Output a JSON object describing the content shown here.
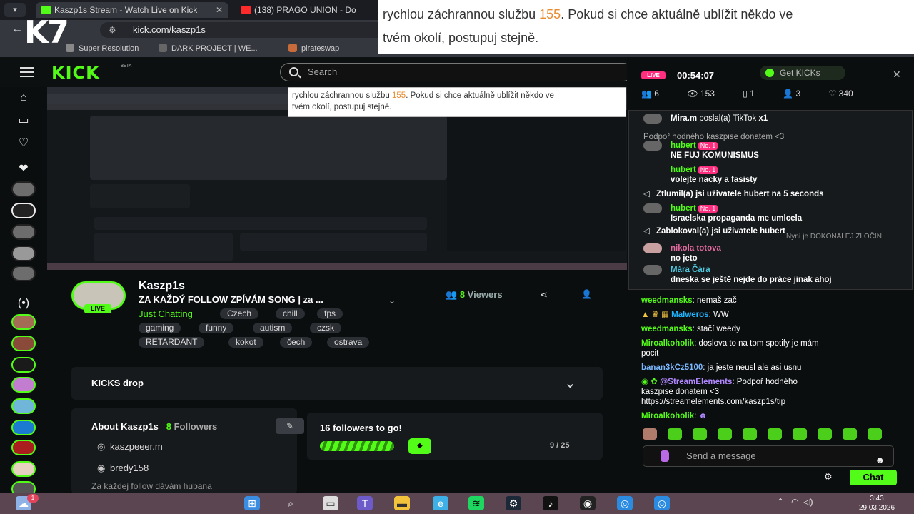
{
  "browser": {
    "tabs": [
      {
        "title": "Kaszp1s Stream - Watch Live on Kick",
        "active": true
      },
      {
        "title": "(138) PRAGO UNION - Do",
        "active": false
      }
    ],
    "url": "kick.com/kaszp1s",
    "bookmarks": [
      "Super Resolution",
      "DARK PROJECT | WE...",
      "pirateswap"
    ]
  },
  "overlay_logo": "K7",
  "top_popup": {
    "line1_pre": "rychlou záchrannou službu ",
    "line1_num": "155",
    "line1_post": ". Pokud si chce aktuálně ublížit někdo ve",
    "line2": "tvém okolí, postupuj stejně."
  },
  "header": {
    "logo": "KICK",
    "beta": "BETA",
    "search_placeholder": "Search"
  },
  "preview_popup": {
    "line1_pre": "rychlou záchrannou službu ",
    "line1_num": "155",
    "line1_post": ". Pokud si chce aktuálně ublížit někdo ve",
    "line2": "tvém okolí, postupuj stejně."
  },
  "channel": {
    "name": "Kaszp1s",
    "live_badge": "LIVE",
    "title": "ZA KAŽDÝ FOLLOW ZPÍVÁM SONG | za ...",
    "category": "Just Chatting",
    "tags": [
      "Czech",
      "chill",
      "fps",
      "gaming",
      "funny",
      "autism",
      "czsk",
      "RETARDANT",
      "kokot",
      "čech",
      "ostrava"
    ],
    "viewers_count": "8",
    "viewers_label": "Viewers"
  },
  "kicks_drop": {
    "label": "KICKS drop"
  },
  "about": {
    "title": "About Kaszp1s",
    "followers_count": "8",
    "followers_label": "Followers",
    "instagram": "kaszpeeer.m",
    "discord": "bredy158",
    "description": "Za každej follow dávám hubana"
  },
  "goal": {
    "title": "16 followers to go!",
    "current": 9,
    "target": 25,
    "progress_text": "9 / 25"
  },
  "chat": {
    "live_badge": "LIVE",
    "uptime": "00:54:07",
    "get_kicks": "Get KICKs",
    "stats": {
      "a": "6",
      "b": "153",
      "c": "1",
      "d": "3",
      "e": "340"
    },
    "overlay_messages": [
      {
        "user": "Mira.m",
        "text": " poslal(a) TikTok ",
        "extra": "x1"
      },
      {
        "user": "",
        "text": "Podpoř hodného kaszpise donatem <3"
      },
      {
        "user": "hubert",
        "badge": "No. 1",
        "text": ""
      },
      {
        "user": "",
        "text": "NE FUJ KOMUNISMUS"
      },
      {
        "user": "hubert",
        "badge": "No. 1",
        "text": ""
      },
      {
        "user": "",
        "text": "volejte nacky a fasisty"
      },
      {
        "user": "",
        "text": "Ztlumil(a) jsi uživatele hubert na 5 seconds"
      },
      {
        "user": "hubert",
        "badge": "No. 1",
        "text": ""
      },
      {
        "user": "",
        "text": "Israelska propaganda me umlcela"
      },
      {
        "user": "",
        "text": "Zablokoval(a) jsi uživatele hubert"
      },
      {
        "user": "",
        "text": "Nyní je DOKONALEJ ZLOČIN"
      },
      {
        "user": "nikola totova",
        "text": ""
      },
      {
        "user": "",
        "text": "no jeto"
      },
      {
        "user": "Mára Čára",
        "text": ""
      },
      {
        "user": "",
        "text": "dneska se ještě nejde do práce jinak ahoj"
      }
    ],
    "messages": [
      {
        "user": "weedmansks",
        "text": ": nemaš zač"
      },
      {
        "user": "Malweros",
        "text": ": WW"
      },
      {
        "user": "weedmansks",
        "text": ": stačí weedy"
      },
      {
        "user": "Miroalkoholik",
        "text": ": doslova to na tom spotify je mám"
      },
      {
        "user": "",
        "text": "pocit"
      },
      {
        "user": "banan3kCz5100",
        "text": ": ja jeste neusl ale asi usnu"
      },
      {
        "user": "@StreamElements",
        "text": ": Podpoř hodného"
      },
      {
        "user": "",
        "text": "kaszpise donatem <3"
      },
      {
        "user": "",
        "text": "https://streamelements.com/kaszp1s/tip"
      },
      {
        "user": "Miroalkoholik",
        "text": ":"
      }
    ],
    "input_placeholder": "Send a message",
    "send_button": "Chat"
  },
  "taskbar": {
    "notification_count": "1",
    "time": "3:43",
    "date": "29.03.2026"
  }
}
